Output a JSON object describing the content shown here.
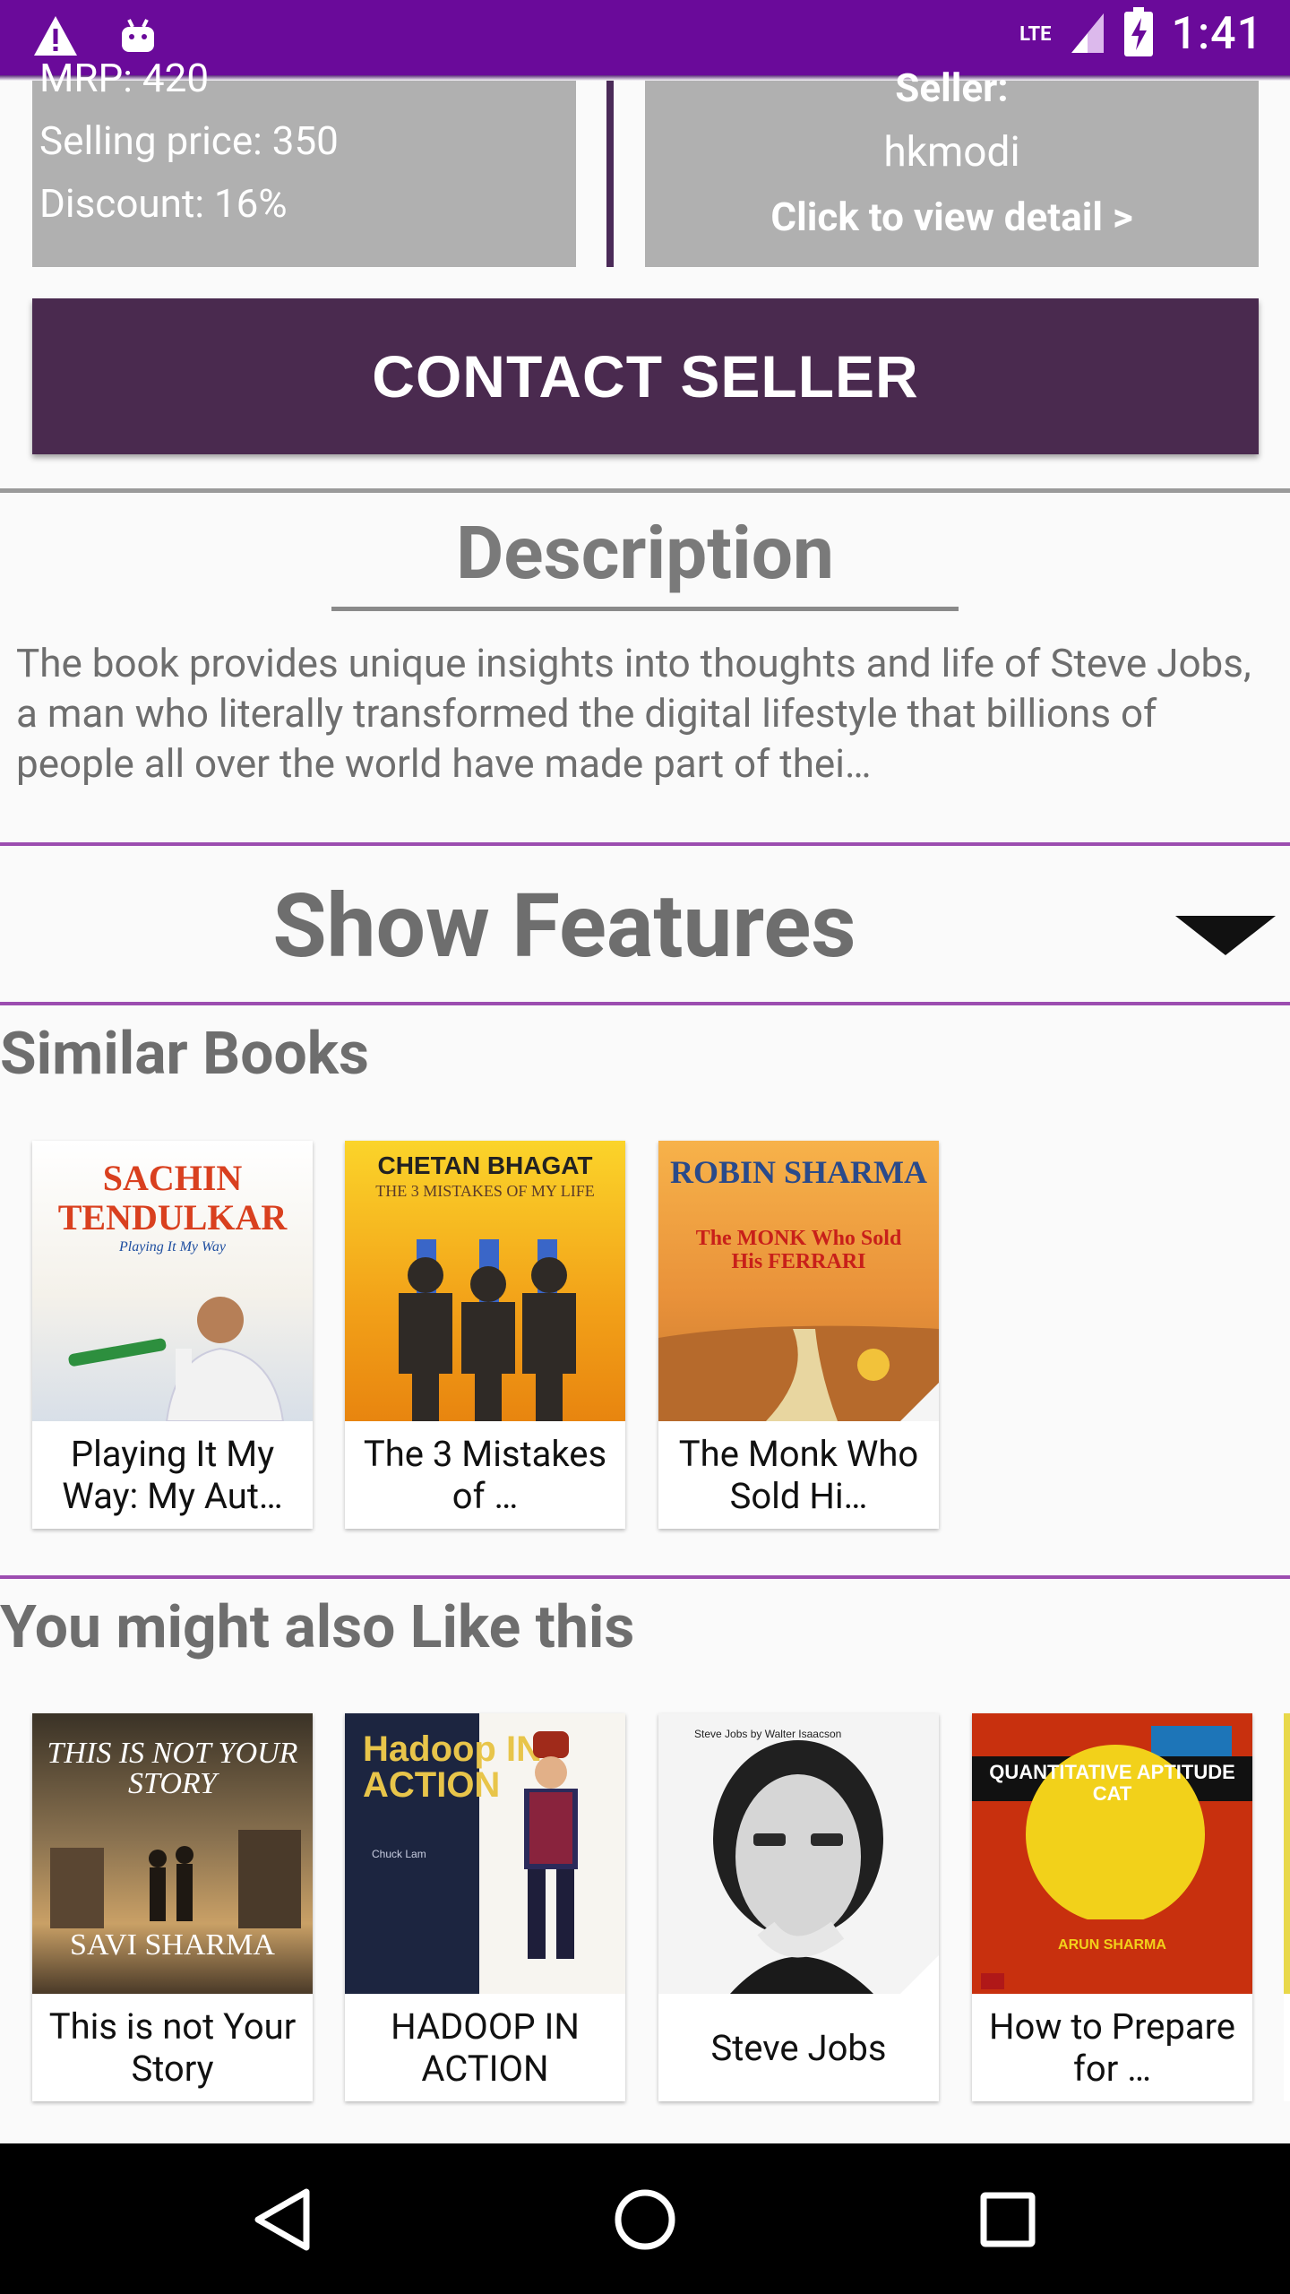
{
  "status_bar": {
    "time": "1:41",
    "network": "LTE"
  },
  "price": {
    "mrp": "MRP: 420",
    "selling": "Selling price: 350",
    "discount": "Discount: 16%"
  },
  "seller": {
    "label": "Seller:",
    "name": "hkmodi",
    "link": "Click to view detail >"
  },
  "contact_button": "CONTACT SELLER",
  "description": {
    "title": "Description",
    "text": "The book provides unique insights into thoughts and life of Steve Jobs, a man who literally transformed the digital lifestyle that billions of people all over the world have made part of thei…"
  },
  "features": {
    "title": "Show Features"
  },
  "similar": {
    "title": "Similar Books",
    "books": [
      {
        "title": "Playing It My Way: My Aut…",
        "cover_author": "SACHIN TENDULKAR",
        "cover_sub": "Playing It My Way"
      },
      {
        "title": "The 3 Mistakes of …",
        "cover_author": "CHETAN BHAGAT",
        "cover_sub": "THE 3 MISTAKES OF MY LIFE"
      },
      {
        "title": "The Monk Who Sold Hi…",
        "cover_author": "ROBIN SHARMA",
        "cover_sub": "The MONK Who Sold His FERRARI"
      }
    ]
  },
  "also_like": {
    "title": "You might also Like this",
    "books": [
      {
        "title": "This is not Your Story",
        "cover_author": "SAVI SHARMA",
        "cover_sub": "THIS IS NOT YOUR STORY"
      },
      {
        "title": "HADOOP IN ACTION",
        "cover_author": "Chuck Lam",
        "cover_sub": "Hadoop IN ACTION"
      },
      {
        "title": "Steve Jobs",
        "cover_author": "Steve Jobs by Walter Isaacson",
        "cover_sub": ""
      },
      {
        "title": "How to Prepare for …",
        "cover_author": "ARUN SHARMA",
        "cover_sub": "QUANTITATIVE APTITUDE CAT"
      }
    ]
  },
  "colors": {
    "status_bar": "#6a0a9a",
    "button": "#4a2a4f",
    "card": "#b0b0b0",
    "accent_line": "#9c4db0"
  }
}
